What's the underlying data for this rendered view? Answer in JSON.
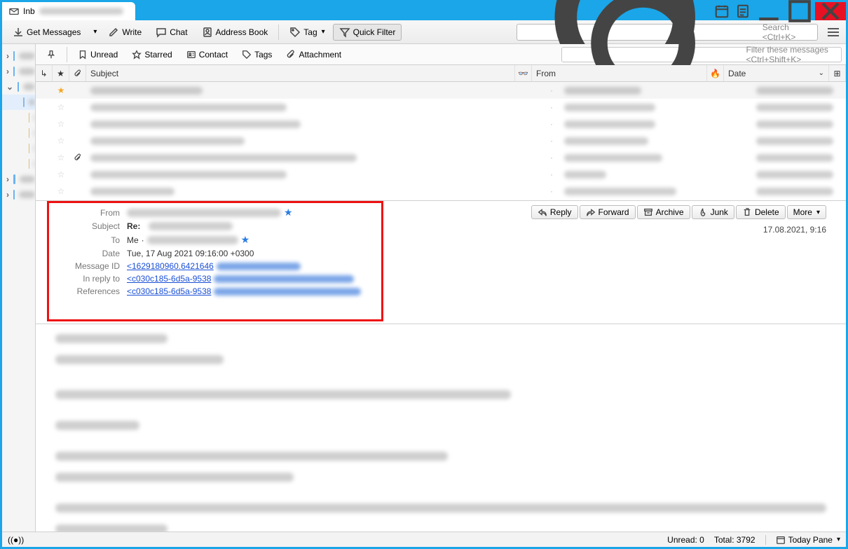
{
  "tab_title": "Inb",
  "toolbar": {
    "get_messages": "Get Messages",
    "write": "Write",
    "chat": "Chat",
    "address_book": "Address Book",
    "tag": "Tag",
    "quick_filter": "Quick Filter",
    "search_placeholder": "Search <Ctrl+K>"
  },
  "filterbar": {
    "unread": "Unread",
    "starred": "Starred",
    "contact": "Contact",
    "tags": "Tags",
    "attachment": "Attachment",
    "filter_placeholder": "Filter these messages <Ctrl+Shift+K>"
  },
  "columns": {
    "subject": "Subject",
    "from": "From",
    "date": "Date"
  },
  "messages": [
    {
      "starred": true,
      "attach": false,
      "subject_w": 160,
      "from_w": 110,
      "date_w": 110
    },
    {
      "starred": false,
      "attach": false,
      "subject_w": 280,
      "from_w": 130,
      "date_w": 110
    },
    {
      "starred": false,
      "attach": false,
      "subject_w": 300,
      "from_w": 130,
      "date_w": 110
    },
    {
      "starred": false,
      "attach": false,
      "subject_w": 220,
      "from_w": 120,
      "date_w": 110
    },
    {
      "starred": false,
      "attach": true,
      "subject_w": 380,
      "from_w": 140,
      "date_w": 110
    },
    {
      "starred": false,
      "attach": false,
      "subject_w": 280,
      "from_w": 60,
      "date_w": 110
    },
    {
      "starred": false,
      "attach": false,
      "subject_w": 120,
      "from_w": 160,
      "date_w": 110
    }
  ],
  "actions": {
    "reply": "Reply",
    "forward": "Forward",
    "archive": "Archive",
    "junk": "Junk",
    "delete": "Delete",
    "more": "More"
  },
  "header": {
    "from_label": "From",
    "subject_label": "Subject",
    "subject_prefix": "Re:",
    "to_label": "To",
    "to_value": "Me",
    "date_label": "Date",
    "date_value": "Tue, 17 Aug 2021 09:16:00 +0300",
    "msgid_label": "Message ID",
    "msgid_value": "<1629180960.6421646",
    "inreply_label": "In reply to",
    "inreply_value": "<c030c185-6d5a-9538",
    "refs_label": "References",
    "refs_value": "<c030c185-6d5a-9538",
    "timestamp": "17.08.2021, 9:16"
  },
  "status": {
    "unread": "Unread: 0",
    "total": "Total: 3792",
    "today_pane": "Today Pane"
  }
}
